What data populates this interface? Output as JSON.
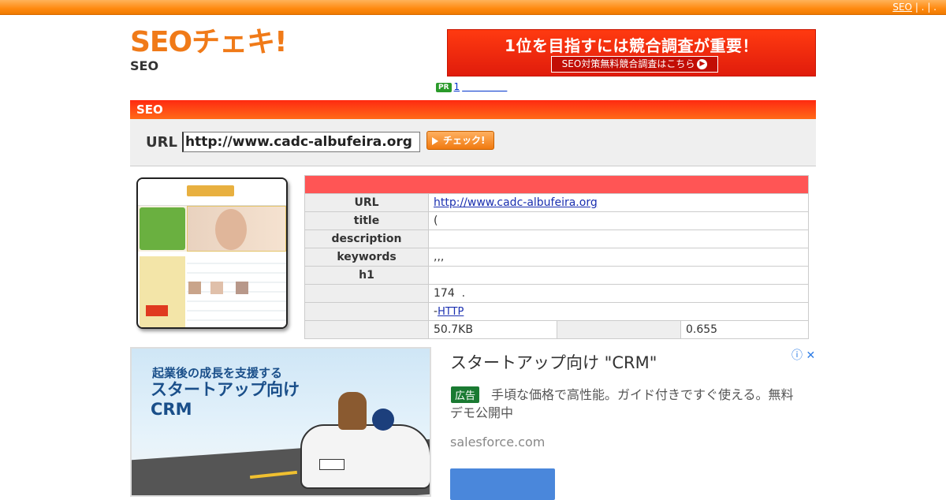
{
  "topnav": {
    "link": "SEO",
    "sep": "| . | ."
  },
  "logo": {
    "text": "SEOチェキ!",
    "sub": "SEO"
  },
  "banner": {
    "title": "1位を目指すには競合調査が重要！",
    "button": "SEO対策無料競合調査はこちら"
  },
  "pr": {
    "badge": "PR",
    "link": "1"
  },
  "section": {
    "title": "SEO"
  },
  "form": {
    "url_label": "URL",
    "url_value": "http://www.cadc-albufeira.org",
    "check_label": "チェック!"
  },
  "result": {
    "rows": [
      {
        "key": "URL",
        "value": "http://www.cadc-albufeira.org",
        "link": true
      },
      {
        "key": "title",
        "value": "("
      },
      {
        "key": "description",
        "value": ""
      },
      {
        "key": "keywords",
        "value": ",,,"
      },
      {
        "key": "h1",
        "value": ""
      },
      {
        "key": "",
        "value": "174  ."
      },
      {
        "key": "",
        "value_prefix": "-",
        "value_link": "HTTP"
      },
      {
        "key": "",
        "value": "50.7KB",
        "key2": "",
        "value2": "0.655"
      }
    ]
  },
  "ad": {
    "image_sub": "起業後の成長を支援する",
    "image_head": "スタートアップ向け CRM",
    "title": "スタートアップ向け \"CRM\"",
    "badge": "広告",
    "desc": "手頃な価格で高性能。ガイド付きですぐ使える。無料デモ公開中",
    "domain": "salesforce.com",
    "info_icon": "info-icon",
    "close_icon": "close-icon"
  },
  "colors": {
    "accent": "#ff8a10",
    "header_red": "#ff2a10",
    "table_header": "#ff5555",
    "link": "#1a2fb0"
  }
}
